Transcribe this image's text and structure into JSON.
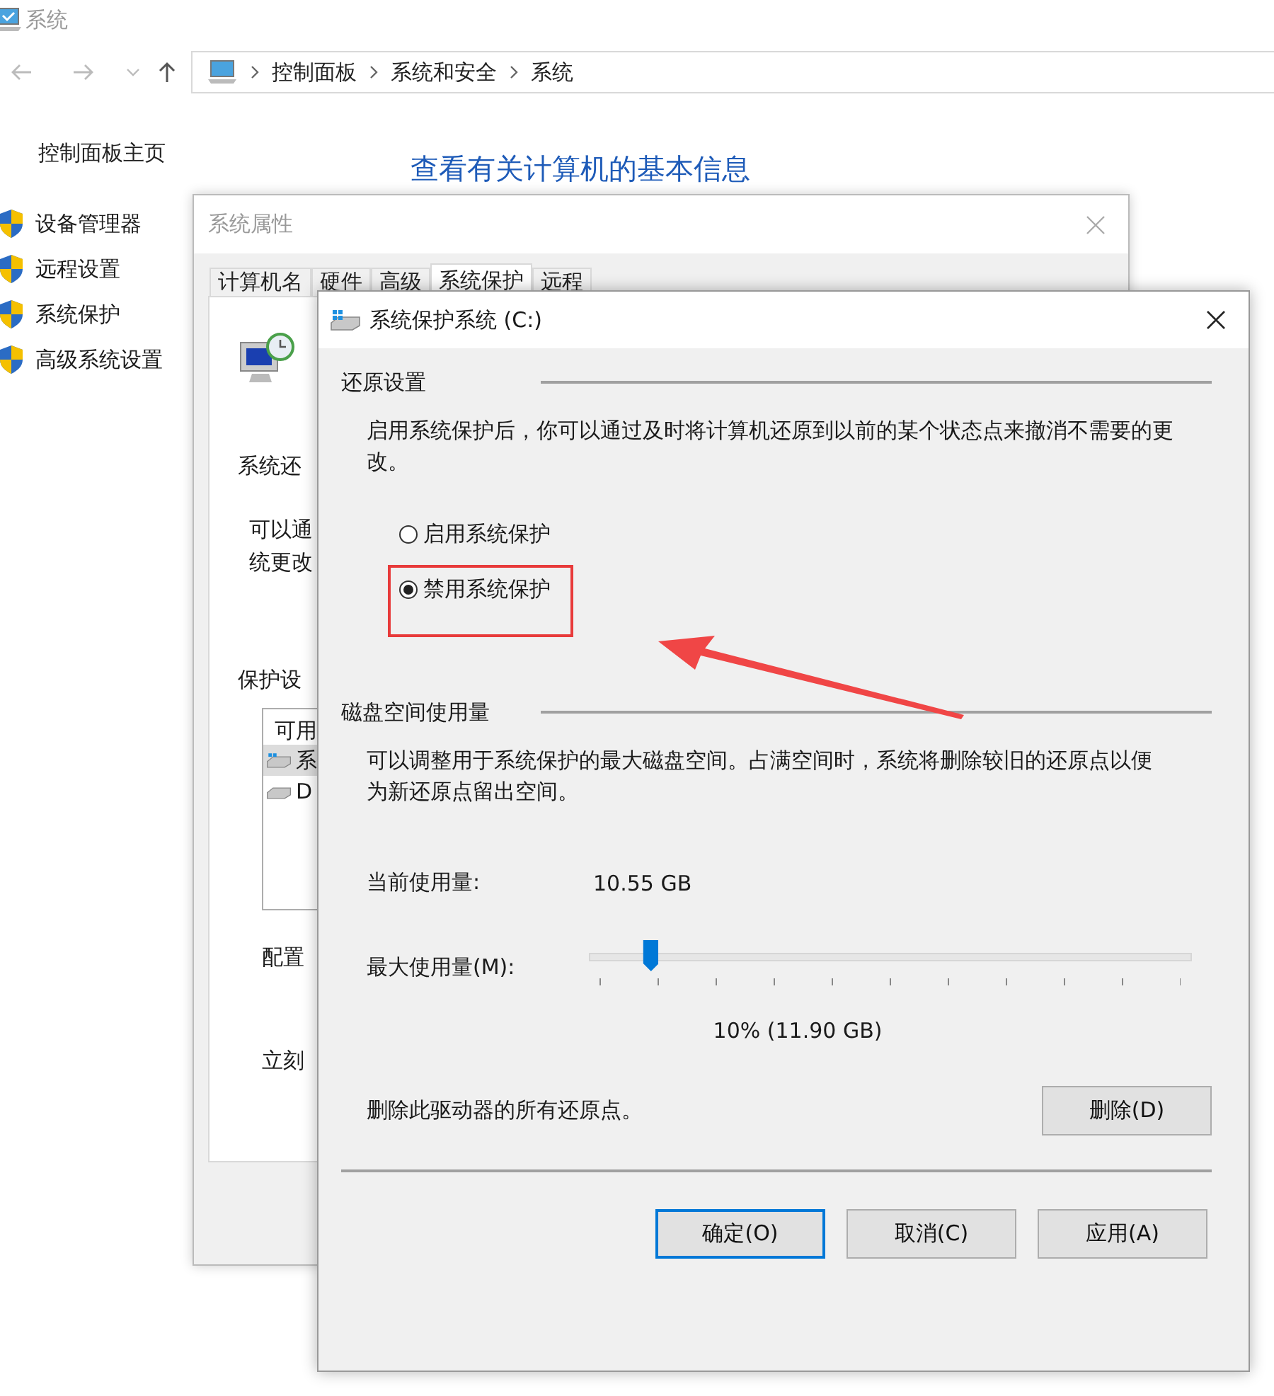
{
  "control_panel": {
    "title": "系统",
    "breadcrumb": [
      "控制面板",
      "系统和安全",
      "系统"
    ],
    "sidebar_home": "控制面板主页",
    "sidebar_items": [
      "设备管理器",
      "远程设置",
      "系统保护",
      "高级系统设置"
    ],
    "heading": "查看有关计算机的基本信息"
  },
  "system_properties": {
    "title": "系统属性",
    "tabs": [
      {
        "label": "计算机名",
        "selected": false
      },
      {
        "label": "硬件",
        "selected": false
      },
      {
        "label": "高级",
        "selected": false
      },
      {
        "label": "系统保护",
        "selected": true
      },
      {
        "label": "远程",
        "selected": false
      }
    ],
    "restore_heading": "系统还",
    "restore_text": [
      "可以通",
      "统更改"
    ],
    "protection_heading": "保护设",
    "list_header": "可用",
    "drives": [
      {
        "label": "系",
        "selected": true
      },
      {
        "label": "D",
        "selected": false
      }
    ],
    "configure_text": "配置",
    "create_text": "立刻"
  },
  "dialog": {
    "title": "系统保护系统 (C:)",
    "restore_group": "还原设置",
    "restore_desc": "启用系统保护后，你可以通过及时将计算机还原到以前的某个状态点来撤消不需要的更改。",
    "options": [
      {
        "label": "启用系统保护",
        "selected": false,
        "highlighted": false
      },
      {
        "label": "禁用系统保护",
        "selected": true,
        "highlighted": true
      }
    ],
    "disk_group": "磁盘空间使用量",
    "disk_desc": "可以调整用于系统保护的最大磁盘空间。占满空间时，系统将删除较旧的还原点以便为新还原点留出空间。",
    "current_label": "当前使用量:",
    "current_value": "10.55 GB",
    "max_label": "最大使用量(M):",
    "max_slider": {
      "level": 0.1
    },
    "max_reading": "10% (11.90 GB)",
    "delete_label": "删除此驱动器的所有还原点。",
    "delete_button": "删除(D)",
    "buttons": [
      {
        "label": "确定(O)",
        "default": true
      },
      {
        "label": "取消(C)",
        "default": false
      },
      {
        "label": "应用(A)",
        "default": false
      }
    ]
  }
}
